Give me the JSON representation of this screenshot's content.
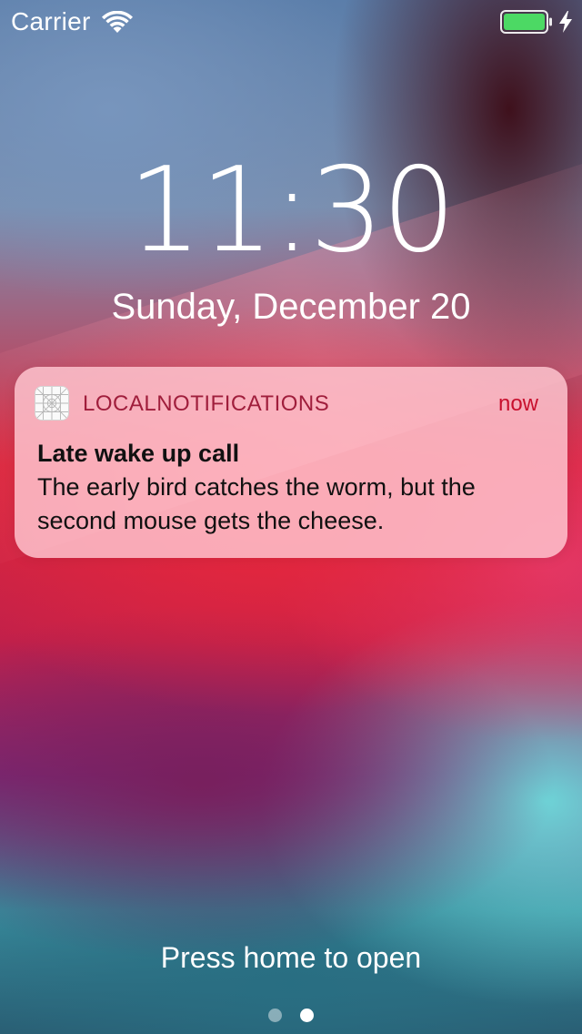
{
  "status_bar": {
    "carrier": "Carrier",
    "wifi_icon": "wifi-icon",
    "battery_icon": "battery-icon",
    "charging_icon": "charging-bolt-icon",
    "battery_level": 1.0,
    "battery_color": "#4cd964"
  },
  "lock_screen": {
    "time": "11:30",
    "date": "Sunday, December 20"
  },
  "notification": {
    "app_icon": "app-placeholder-icon",
    "app_name": "LOCALNOTIFICATIONS",
    "time": "now",
    "title": "Late wake up call",
    "body": "The early bird catches the worm, but the second mouse gets the cheese."
  },
  "bottom": {
    "hint": "Press home to open",
    "page_count": 2,
    "current_page": 2
  }
}
